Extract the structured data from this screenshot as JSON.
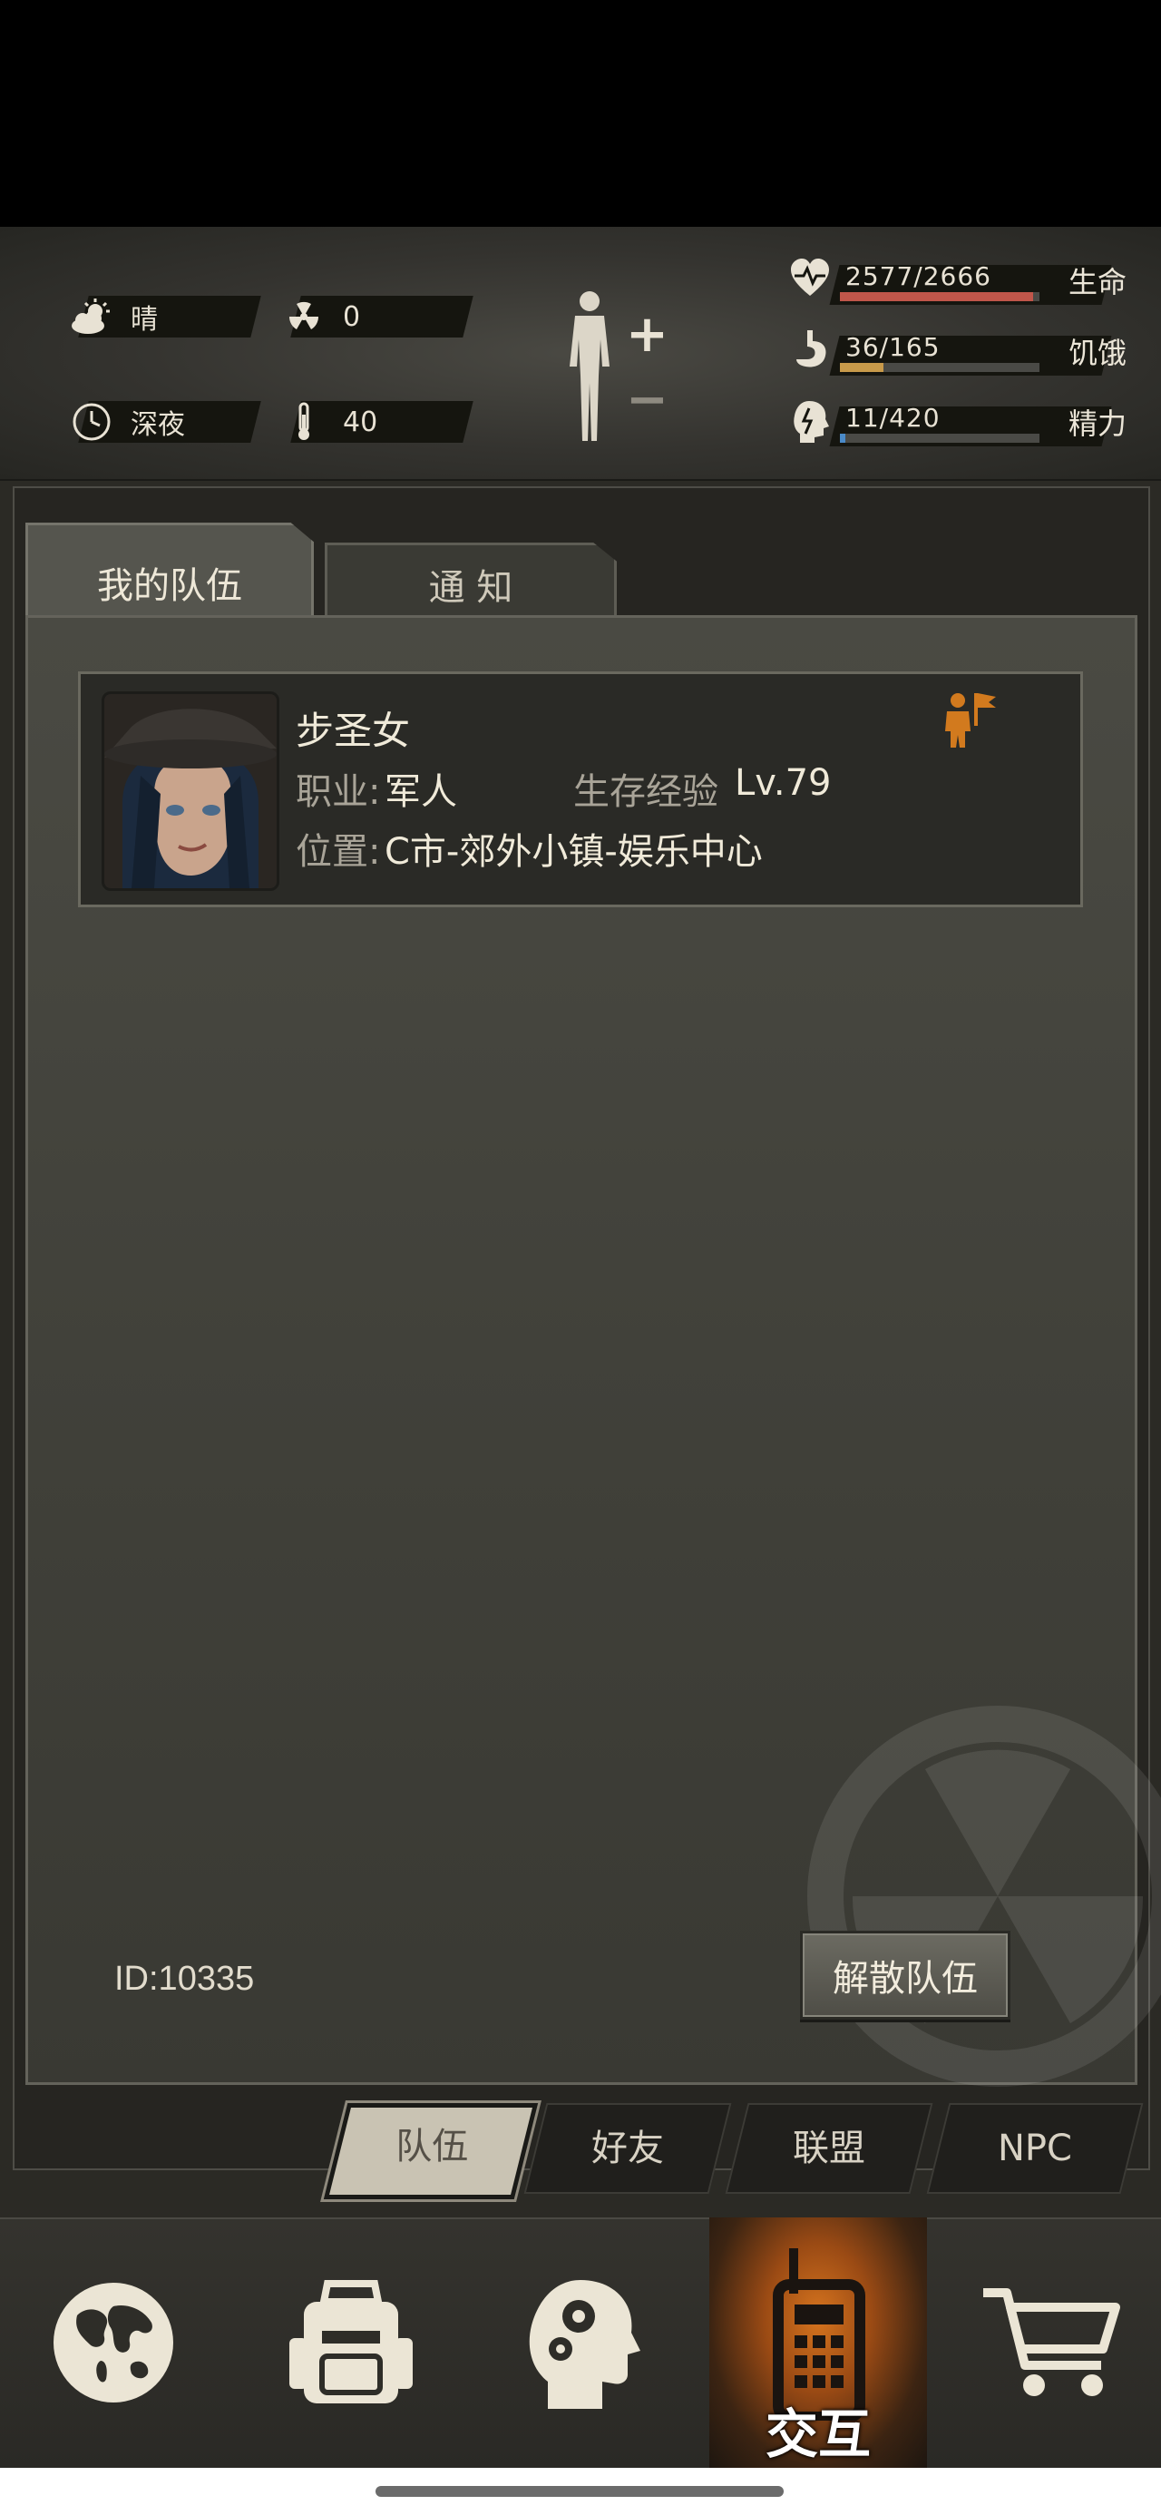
{
  "hud": {
    "weather": {
      "icon": "sun-cloud-icon",
      "label": "晴"
    },
    "radiation": {
      "icon": "radiation-icon",
      "value": "0"
    },
    "time": {
      "icon": "clock-icon",
      "label": "深夜"
    },
    "temperature": {
      "icon": "thermometer-icon",
      "value": "40"
    },
    "body_controls": {
      "plus": "+",
      "minus": "−"
    },
    "stats": [
      {
        "icon": "heart-icon",
        "value": "2577/2666",
        "label": "生命",
        "fill": 0.967,
        "color": "#c0564a"
      },
      {
        "icon": "stomach-icon",
        "value": "36/165",
        "label": "饥饿",
        "fill": 0.218,
        "color": "#c89a4a"
      },
      {
        "icon": "brain-icon",
        "value": "11/420",
        "label": "精力",
        "fill": 0.026,
        "color": "#4a8ac8"
      }
    ]
  },
  "tabs": {
    "team": "我的队伍",
    "notice": "通 知"
  },
  "member": {
    "name": "步圣女",
    "job_label": "职业:",
    "job_value": "军人",
    "exp_label": "生存经验",
    "exp_value": "Lv.79",
    "loc_label": "位置:",
    "loc_value": "C市-郊外小镇-娱乐中心",
    "leader_icon": "leader-flag-icon"
  },
  "team_id": "ID:10335",
  "disband_button": "解散队伍",
  "subtabs": [
    "队伍",
    "好友",
    "联盟",
    "NPC"
  ],
  "active_subtab": "队伍",
  "nav": {
    "world": "globe-icon",
    "bag": "backpack-icon",
    "skills": "head-gears-icon",
    "interact": "walkie-talkie-icon",
    "interact_label": "交互",
    "shop": "shopping-cart-icon"
  }
}
